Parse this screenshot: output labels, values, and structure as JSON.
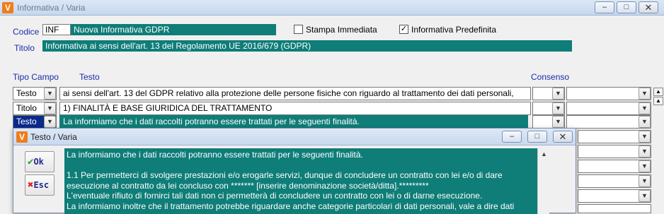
{
  "window": {
    "title": "Informativa / Varia",
    "app_icon": "V",
    "minimize": "–",
    "maximize": "□",
    "close": "✕"
  },
  "form": {
    "codice_label": "Codice",
    "codice_value": "INF",
    "descrizione_value": "Nuova Informativa GDPR",
    "stampa_label": "Stampa Immediata",
    "stampa_checked": false,
    "predefinita_label": "Informativa Predefinita",
    "predefinita_checked": true,
    "titolo_label": "Titolo",
    "titolo_value": "Informativa ai sensi dell'art. 13 del Regolamento UE 2016/679 (GDPR)"
  },
  "grid": {
    "col_tipo": "Tipo Campo",
    "col_testo": "Testo",
    "col_consenso": "Consenso",
    "rows": [
      {
        "tipo": "Testo",
        "testo": "ai sensi dell'art. 13 del GDPR relativo alla protezione delle persone fisiche con riguardo al trattamento dei dati personali,",
        "selected": false
      },
      {
        "tipo": "Titolo",
        "testo": "1)   FINALITÀ E BASE GIURIDICA DEL TRATTAMENTO",
        "selected": false
      },
      {
        "tipo": "Testo",
        "testo": "La informiamo che i dati raccolti potranno essere trattati per le seguenti finalità.",
        "selected": true
      }
    ]
  },
  "dialog": {
    "title": "Testo / Varia",
    "ok_label": "Ok",
    "esc_label": "Esc",
    "text_lines": [
      "La informiamo che i dati raccolti potranno essere trattati per le seguenti finalità.",
      "",
      "1.1 Per permetterci di svolgere prestazioni e/o erogarle servizi, dunque di concludere un contratto con lei e/o di dare",
      "esecuzione al contratto da lei concluso con ******* [inserire denominazione società/ditta].*********",
      "L'eventuale rifiuto di fornirci tali dati non ci permetterà di concludere un contratto con lei o di darne esecuzione.",
      "La informiamo inoltre che il trattamento potrebbe riguardare anche categorie particolari di dati personali, vale a dire dati"
    ]
  },
  "colors": {
    "label_blue": "#1a2ca8",
    "field_teal": "#0f7d78",
    "selected_navy": "#0a2b8c"
  },
  "icons": {
    "ok": "check-icon",
    "esc": "cancel-x-icon",
    "dropdown": "chevron-down-icon"
  }
}
